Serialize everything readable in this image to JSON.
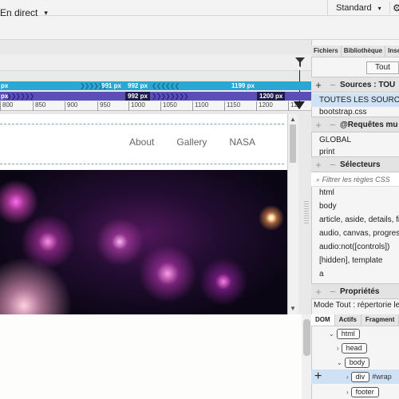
{
  "topbar": {
    "workspace": "Standard",
    "workspace_caret": "▾",
    "gear": "⚙"
  },
  "docbar": {
    "live_label": "En direct",
    "live_caret": "▾"
  },
  "media_queries": {
    "bar1": {
      "left_label": "px",
      "mid_label": "991 px",
      "label2": "992 px",
      "right_label": "1199 px"
    },
    "bar2": {
      "left_label": "px",
      "mid_label": "992 px",
      "right_label": "1200 px"
    }
  },
  "ruler": {
    "ticks": [
      "800",
      "850",
      "900",
      "950",
      "1000",
      "1050",
      "1100",
      "1150",
      "1200",
      "12"
    ]
  },
  "preview": {
    "nav": [
      "About",
      "Gallery",
      "NASA"
    ]
  },
  "panel_tabs": [
    "Fichiers",
    "Bibliothèque",
    "Inse"
  ],
  "sources": {
    "tout_button": "Tout",
    "title": "Sources : TOU",
    "items": [
      "TOUTES LES SOURCES",
      "bootstrap.css"
    ]
  },
  "media_panel": {
    "title": "@Requêtes mu",
    "items": [
      "GLOBAL",
      "print"
    ]
  },
  "selectors": {
    "title": "Sélecteurs",
    "filter_placeholder": "Filtrer les règles CSS",
    "items": [
      "html",
      "body",
      "article, aside, details, fig",
      "audio, canvas, progress,",
      "audio:not([controls])",
      "[hidden], template",
      "a"
    ]
  },
  "properties": {
    "title": "Propriétés",
    "mode": "Mode Tout : répertorie les"
  },
  "dom": {
    "tabs": [
      "DOM",
      "Actifs",
      "Fragment"
    ],
    "nodes": [
      {
        "tag": "html",
        "suffix": ""
      },
      {
        "tag": "head",
        "suffix": ""
      },
      {
        "tag": "body",
        "suffix": ""
      },
      {
        "tag": "div",
        "suffix": "#wrap"
      },
      {
        "tag": "footer",
        "suffix": ""
      }
    ]
  },
  "icons": {
    "filter": "filter-icon",
    "plus": "+",
    "minus": "−"
  }
}
